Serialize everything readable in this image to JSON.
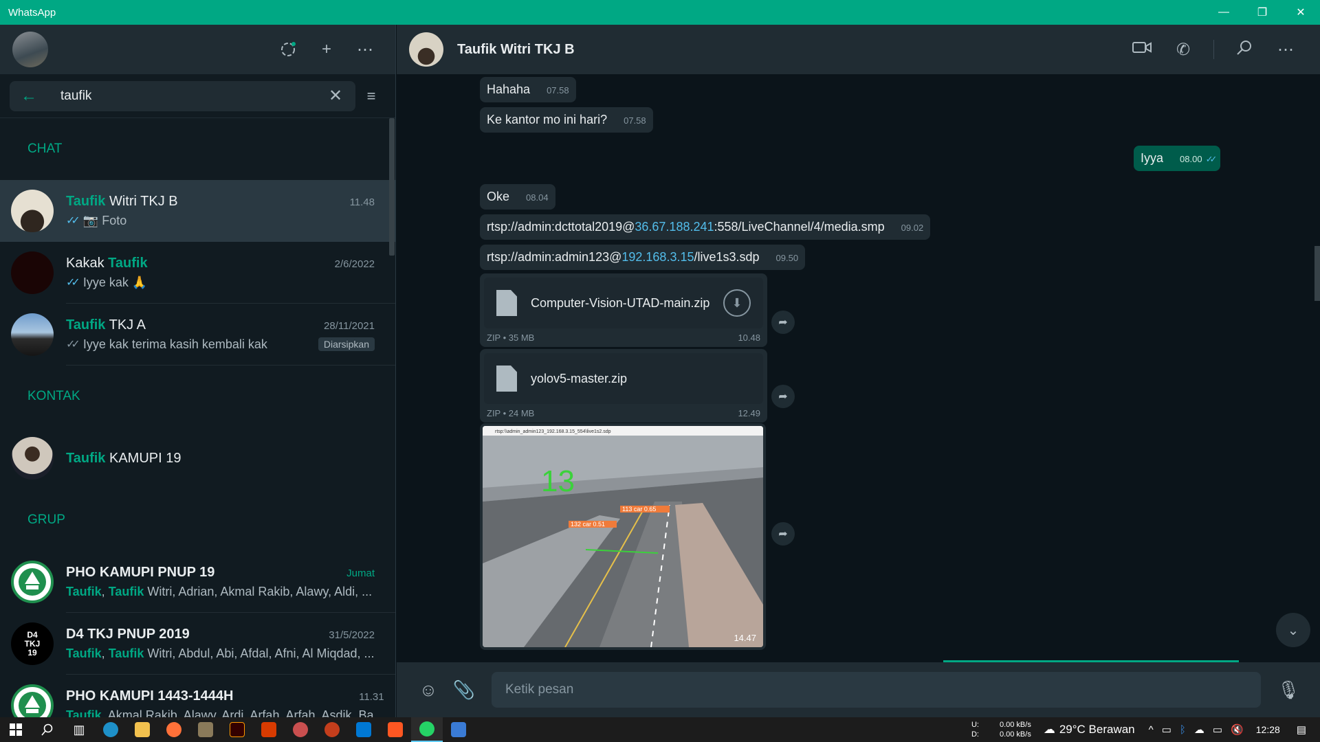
{
  "window": {
    "title": "WhatsApp"
  },
  "search": {
    "value": "taufik"
  },
  "sections": {
    "chat": "CHAT",
    "contacts": "KONTAK",
    "groups": "GRUP"
  },
  "chats": [
    {
      "name_hl": "Taufik",
      "name_rest": " Witri TKJ B",
      "time": "11.48",
      "ticks": "✓✓",
      "preview": "📷 Foto"
    },
    {
      "name_pre": "Kakak ",
      "name_hl": "Taufik",
      "time": "2/6/2022",
      "ticks": "✓✓",
      "preview": "Iyye kak 🙏"
    },
    {
      "name_hl": "Taufik",
      "name_rest": " TKJ A",
      "time": "28/11/2021",
      "ticks": "✓✓",
      "preview": "Iyye kak terima kasih kembali kak",
      "badge": "Diarsipkan"
    }
  ],
  "contacts": [
    {
      "name_hl": "Taufik",
      "name_rest": " KAMUPI 19"
    }
  ],
  "groups": [
    {
      "name": "PHO KAMUPI PNUP 19",
      "time": "Jumat",
      "hl1": "Taufik",
      "sep": ", ",
      "hl2": "Taufik",
      "rest": " Witri, Adrian, Akmal Rakib, Alawy, Aldi, ..."
    },
    {
      "name": "D4 TKJ PNUP 2019",
      "time": "31/5/2022",
      "hl1": "Taufik",
      "sep": ", ",
      "hl2": "Taufik",
      "rest": " Witri, Abdul, Abi, Afdal, Afni, Al Miqdad, ...",
      "avatar_text": "D4\nTKJ\n19"
    },
    {
      "name": "PHO KAMUPI 1443-1444H",
      "time": "11.31",
      "hl1": "Taufik",
      "sep": ", ",
      "hl2": "",
      "rest": "Akmal Rakib, Alawy, Ardi, Arfah, Arfah, Asdik, Ba..."
    }
  ],
  "conversation": {
    "contact_name": "Taufik Witri TKJ B",
    "messages": [
      {
        "text": "Hahaha",
        "time": "07.58"
      },
      {
        "text": "Ke kantor mo ini hari?",
        "time": "07.58"
      },
      {
        "text": "Iyya",
        "time": "08.00",
        "ticks": "✓✓"
      },
      {
        "text": "Oke",
        "time": "08.04"
      },
      {
        "pre": "rtsp://admin:dcttotal2019@",
        "link": "36.67.188.241",
        "post": ":558/LiveChannel/4/media.smp",
        "time": "09.02"
      },
      {
        "pre": "rtsp://admin:admin123@",
        "link": "192.168.3.15",
        "post": "/live1s3.sdp",
        "time": "09.50"
      }
    ],
    "files": [
      {
        "name": "Computer-Vision-UTAD-main.zip",
        "meta": "ZIP • 35 MB",
        "time": "10.48"
      },
      {
        "name": "yolov5-master.zip",
        "meta": "ZIP • 24 MB",
        "time": "12.49"
      }
    ],
    "image": {
      "window_title": "rtsp:\\\\admin_admin123_192.168.3.15_554\\live1s2.sdp",
      "count": "13",
      "label1": "113 car 0.65",
      "label2": "132 car 0.51",
      "time": "14.47"
    }
  },
  "composer": {
    "placeholder": "Ketik pesan"
  },
  "taskbar": {
    "net_u_label": "U:",
    "net_d_label": "D:",
    "net_u": "0.00 kB/s",
    "net_d": "0.00 kB/s",
    "weather": "29°C  Berawan",
    "clock": "12:28"
  },
  "colors": {
    "accent": "#00a884",
    "link": "#53bdeb",
    "outgoing_bubble": "#005c4b",
    "incoming_bubble": "#202c33"
  }
}
